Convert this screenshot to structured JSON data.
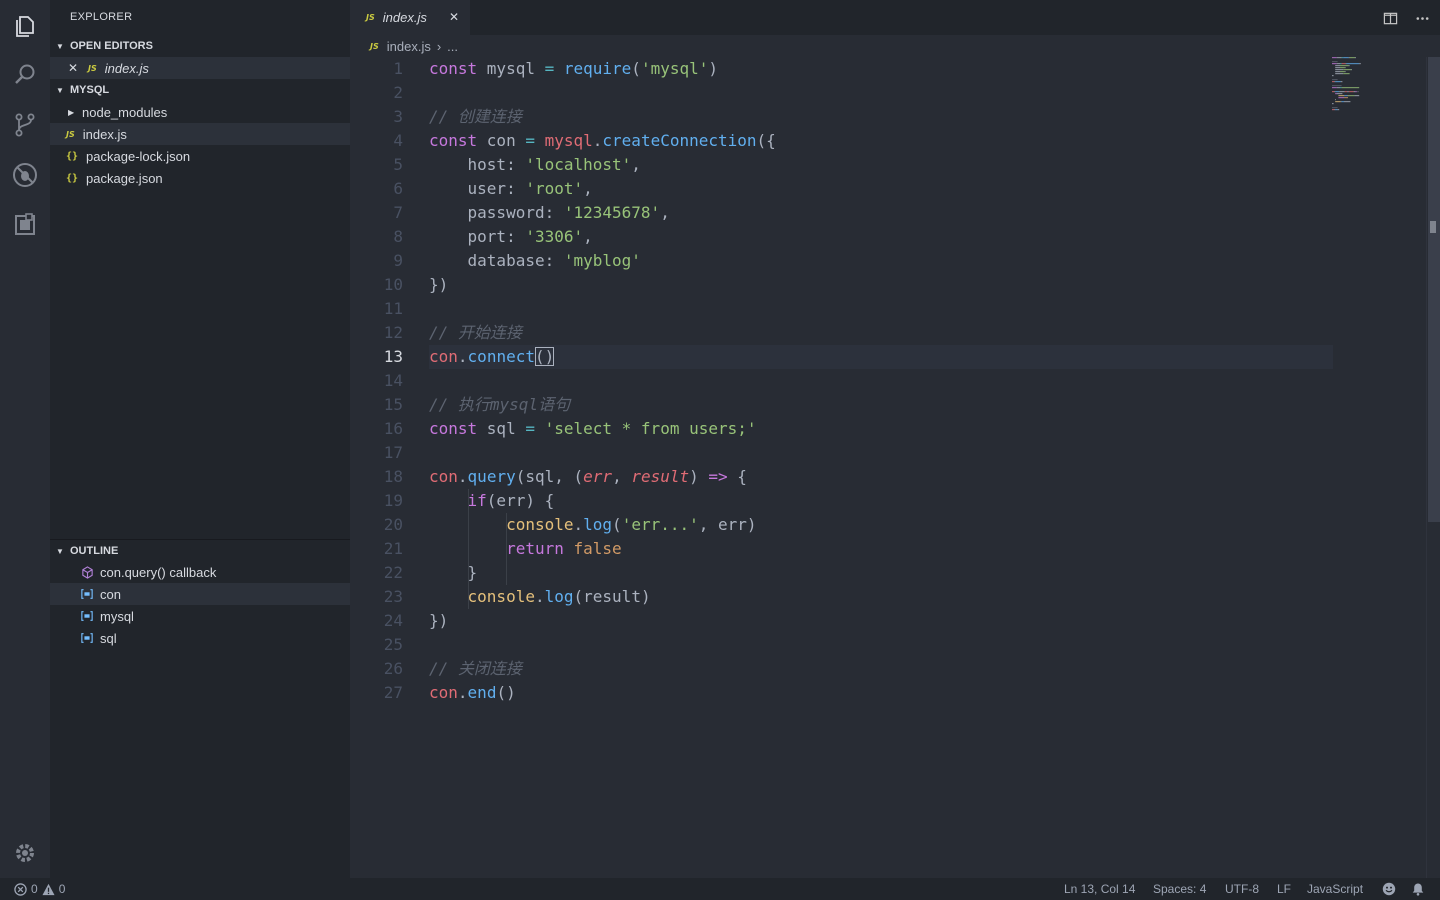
{
  "colors": {
    "accent": "#528bff",
    "bg_editor": "#282c34",
    "bg_sidebar": "#21252b",
    "js_icon": "#cbcb41"
  },
  "activity_bar": [
    "files-icon",
    "search-icon",
    "source-control-icon",
    "debug-icon",
    "extensions-icon",
    "gear-icon"
  ],
  "sidebar": {
    "title": "EXPLORER",
    "open_editors": {
      "header": "OPEN EDITORS",
      "items": [
        {
          "badge": "JS",
          "label": "index.js"
        }
      ]
    },
    "project": {
      "header": "MYSQL",
      "items": [
        {
          "kind": "folder",
          "label": "node_modules"
        },
        {
          "kind": "js",
          "badge": "JS",
          "label": "index.js"
        },
        {
          "kind": "json",
          "badge": "{}",
          "label": "package-lock.json"
        },
        {
          "kind": "json",
          "badge": "{}",
          "label": "package.json"
        }
      ]
    },
    "outline": {
      "header": "OUTLINE",
      "items": [
        {
          "icon": "method-icon",
          "label": "con.query() callback"
        },
        {
          "icon": "variable-icon",
          "label": "con"
        },
        {
          "icon": "variable-icon",
          "label": "mysql"
        },
        {
          "icon": "variable-icon",
          "label": "sql"
        }
      ]
    }
  },
  "tabs": [
    {
      "badge": "JS",
      "label": "index.js",
      "close": "✕"
    }
  ],
  "breadcrumb": {
    "badge": "JS",
    "file": "index.js",
    "sep": "›",
    "rest": "..."
  },
  "editor": {
    "current_line": 13,
    "lines": [
      [
        [
          "kw",
          "const "
        ],
        [
          "pl",
          "mysql "
        ],
        [
          "op",
          "= "
        ],
        [
          "fn",
          "require"
        ],
        [
          "pl",
          "("
        ],
        [
          "str",
          "'mysql'"
        ],
        [
          "pl",
          ")"
        ]
      ],
      [],
      [
        [
          "cm",
          "// 创建连接"
        ]
      ],
      [
        [
          "kw",
          "const "
        ],
        [
          "pl",
          "con "
        ],
        [
          "op",
          "= "
        ],
        [
          "var",
          "mysql"
        ],
        [
          "pl",
          "."
        ],
        [
          "fn",
          "createConnection"
        ],
        [
          "pl",
          "({"
        ]
      ],
      [
        [
          "pl",
          "    host: "
        ],
        [
          "str",
          "'localhost'"
        ],
        [
          "pl",
          ","
        ]
      ],
      [
        [
          "pl",
          "    user: "
        ],
        [
          "str",
          "'root'"
        ],
        [
          "pl",
          ","
        ]
      ],
      [
        [
          "pl",
          "    password: "
        ],
        [
          "str",
          "'12345678'"
        ],
        [
          "pl",
          ","
        ]
      ],
      [
        [
          "pl",
          "    port: "
        ],
        [
          "str",
          "'3306'"
        ],
        [
          "pl",
          ","
        ]
      ],
      [
        [
          "pl",
          "    database: "
        ],
        [
          "str",
          "'myblog'"
        ]
      ],
      [
        [
          "pl",
          "})"
        ]
      ],
      [],
      [
        [
          "cm",
          "// 开始连接"
        ]
      ],
      [
        [
          "var",
          "con"
        ],
        [
          "pl",
          "."
        ],
        [
          "fn",
          "connect"
        ],
        [
          "bk",
          "()"
        ]
      ],
      [],
      [
        [
          "cm",
          "// 执行mysql语句"
        ]
      ],
      [
        [
          "kw",
          "const "
        ],
        [
          "pl",
          "sql "
        ],
        [
          "op",
          "= "
        ],
        [
          "str",
          "'select * from users;'"
        ]
      ],
      [],
      [
        [
          "var",
          "con"
        ],
        [
          "pl",
          "."
        ],
        [
          "fn",
          "query"
        ],
        [
          "pl",
          "(sql, ("
        ],
        [
          "par",
          "err"
        ],
        [
          "pl",
          ", "
        ],
        [
          "par",
          "result"
        ],
        [
          "pl",
          ") "
        ],
        [
          "kw",
          "=>"
        ],
        [
          "pl",
          " {"
        ]
      ],
      [
        [
          "pl",
          "    "
        ],
        [
          "kw",
          "if"
        ],
        [
          "pl",
          "(err) {"
        ]
      ],
      [
        [
          "pl",
          "        "
        ],
        [
          "yl",
          "console"
        ],
        [
          "pl",
          "."
        ],
        [
          "fn",
          "log"
        ],
        [
          "pl",
          "("
        ],
        [
          "str",
          "'err...'"
        ],
        [
          "pl",
          ", err)"
        ]
      ],
      [
        [
          "pl",
          "        "
        ],
        [
          "kw",
          "return "
        ],
        [
          "num",
          "false"
        ]
      ],
      [
        [
          "pl",
          "    }"
        ]
      ],
      [
        [
          "pl",
          "    "
        ],
        [
          "yl",
          "console"
        ],
        [
          "pl",
          "."
        ],
        [
          "fn",
          "log"
        ],
        [
          "pl",
          "(result)"
        ]
      ],
      [
        [
          "pl",
          "})"
        ]
      ],
      [],
      [
        [
          "cm",
          "// 关闭连接"
        ]
      ],
      [
        [
          "var",
          "con"
        ],
        [
          "pl",
          "."
        ],
        [
          "fn",
          "end"
        ],
        [
          "pl",
          "()"
        ]
      ]
    ]
  },
  "status": {
    "errors": "0",
    "warnings": "0",
    "position": "Ln 13, Col 14",
    "spaces": "Spaces: 4",
    "encoding": "UTF-8",
    "eol": "LF",
    "language": "JavaScript"
  }
}
